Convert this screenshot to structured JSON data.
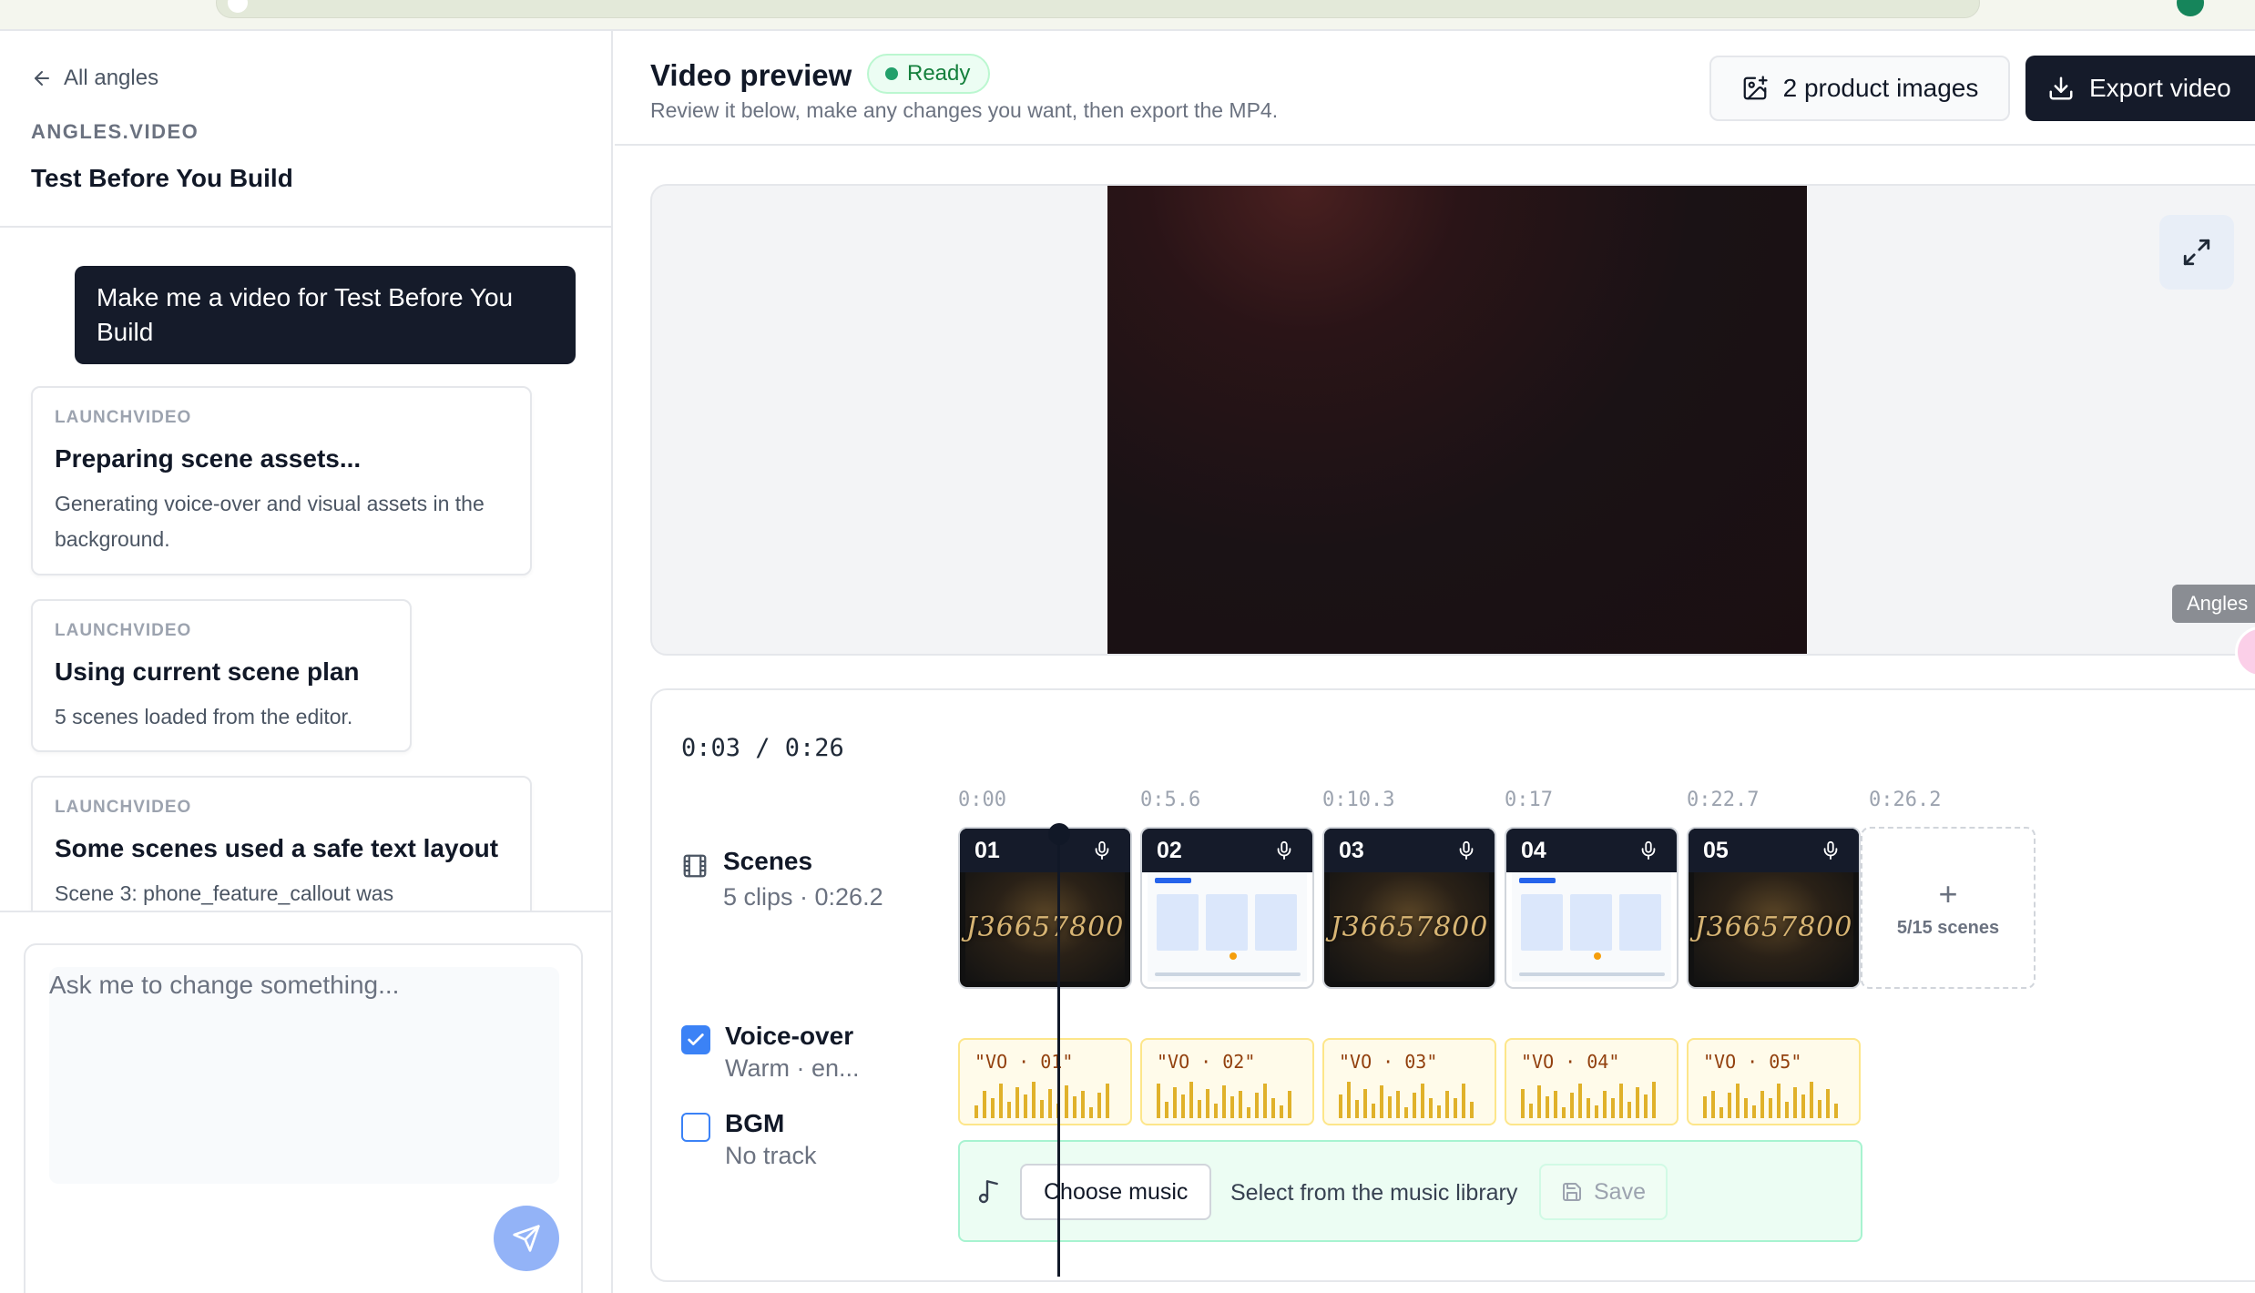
{
  "sidebar": {
    "back_label": "All angles",
    "brand": "ANGLES.VIDEO",
    "project_title": "Test Before You Build",
    "user_message": "Make me a video for Test Before You Build",
    "cards": [
      {
        "source": "LAUNCHVIDEO",
        "title": "Preparing scene assets...",
        "description": "Generating voice-over and visual assets in the background."
      },
      {
        "source": "LAUNCHVIDEO",
        "title": "Using current scene plan",
        "description": "5 scenes loaded from the editor."
      },
      {
        "source": "LAUNCHVIDEO",
        "title": "Some scenes used a safe text layout",
        "description": "Scene 3: phone_feature_callout was"
      }
    ],
    "composer_placeholder": "Ask me to change something..."
  },
  "header": {
    "title": "Video preview",
    "status": "Ready",
    "subtitle": "Review it below, make any changes you want, then export the MP4.",
    "product_images_label": "2 product images",
    "export_label": "Export video"
  },
  "preview": {
    "watermark": "Angles"
  },
  "timeline": {
    "timecode": "0:03 / 0:26",
    "ruler": [
      "0:00",
      "0:5.6",
      "0:10.3",
      "0:17",
      "0:22.7",
      "0:26.2"
    ],
    "scenes_track": {
      "name": "Scenes",
      "sub": "5 clips · 0:26.2"
    },
    "voiceover_track": {
      "name": "Voice-over",
      "sub": "Warm · en...",
      "checked": true
    },
    "bgm_track": {
      "name": "BGM",
      "sub": "No track",
      "checked": false
    },
    "scenes": [
      {
        "num": "01",
        "thumb": "dark",
        "thumb_text": "J36657800"
      },
      {
        "num": "02",
        "thumb": "light",
        "thumb_text": ""
      },
      {
        "num": "03",
        "thumb": "dark",
        "thumb_text": "J36657800"
      },
      {
        "num": "04",
        "thumb": "light",
        "thumb_text": ""
      },
      {
        "num": "05",
        "thumb": "dark",
        "thumb_text": "J36657800"
      }
    ],
    "scene_count": "5/15 scenes",
    "add_symbol": "+",
    "vo_clips": [
      "\"VO · 01\"",
      "\"VO · 02\"",
      "\"VO · 03\"",
      "\"VO · 04\"",
      "\"VO · 05\""
    ],
    "bgm": {
      "choose_label": "Choose music",
      "hint": "Select from the music library",
      "save_label": "Save"
    }
  },
  "colors": {
    "accent_dark": "#151b2a",
    "status_green": "#15803d",
    "checkbox_blue": "#3b82f6",
    "vo_yellow": "#e0b12a",
    "bgm_green": "#ecfdf3"
  },
  "icons": [
    "arrow-left-icon",
    "image-plus-icon",
    "download-icon",
    "expand-icon",
    "film-icon",
    "mic-icon",
    "check-icon",
    "music-note-icon",
    "save-icon",
    "send-icon"
  ]
}
